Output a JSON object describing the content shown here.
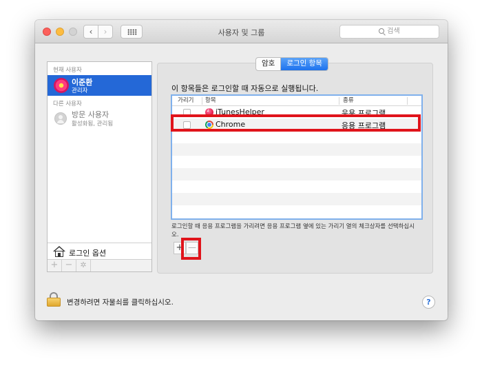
{
  "window": {
    "title": "사용자 및 그룹",
    "search_placeholder": "검색"
  },
  "toolbar": {
    "back_glyph": "‹",
    "forward_glyph": "›"
  },
  "sidebar": {
    "current_user_header": "현재 사용자",
    "current_user": {
      "name": "이준환",
      "role": "관리자"
    },
    "other_users_header": "다른 사용자",
    "guest": {
      "name": "방문 사용자",
      "status": "활성화됨, 관리됨"
    },
    "login_options_label": "로그인 옵션",
    "tools": [
      "+",
      "−",
      "✲"
    ]
  },
  "tabs": [
    {
      "label": "암호",
      "active": false
    },
    {
      "label": "로그인 항목",
      "active": true
    }
  ],
  "login_items": {
    "instruction": "이 항목들은 로그인할 때 자동으로 실행됩니다.",
    "columns": {
      "hide": "가리기",
      "item": "항목",
      "kind": "종류"
    },
    "rows": [
      {
        "name": "iTunesHelper",
        "kind": "응용 프로그램",
        "icon": "itunes-icon"
      },
      {
        "name": "Chrome",
        "kind": "응용 프로그램",
        "icon": "chrome-icon"
      }
    ],
    "hint": "로그인할 때 응용 프로그램을 가리려면 응용 프로그램 옆에 있는 가리기 열의 체크상자를 선택하십시오.",
    "add_label": "+",
    "remove_label": "—"
  },
  "footer": {
    "lock_text": "변경하려면 자물쇠를 클릭하십시오.",
    "help_label": "?"
  },
  "colors": {
    "selection": "#2468d7",
    "highlight": "#e0141b",
    "active_tab": "#1d72ee"
  }
}
